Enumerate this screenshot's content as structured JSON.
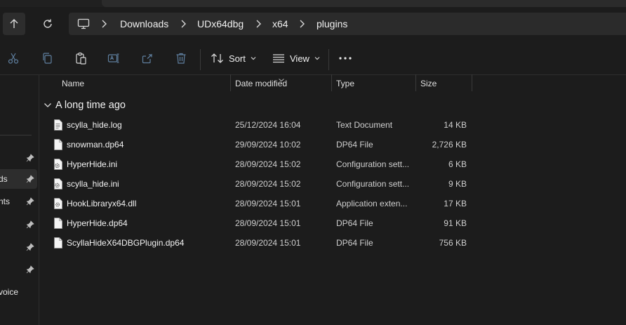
{
  "breadcrumb": {
    "items": [
      {
        "label": "Downloads"
      },
      {
        "label": "UDx64dbg"
      },
      {
        "label": "x64"
      },
      {
        "label": "plugins"
      }
    ]
  },
  "toolbar": {
    "sort_label": "Sort",
    "view_label": "View"
  },
  "sidebar": {
    "items": [
      {
        "label": ""
      },
      {
        "label": "ds"
      },
      {
        "label": "nts"
      },
      {
        "label": ""
      },
      {
        "label": ""
      },
      {
        "label": ""
      },
      {
        "label": "voice"
      }
    ]
  },
  "columns": {
    "name": "Name",
    "date": "Date modified",
    "type": "Type",
    "size": "Size"
  },
  "group": {
    "title": "A long time ago"
  },
  "files": [
    {
      "name": "scylla_hide.log",
      "date": "25/12/2024 16:04",
      "type": "Text Document",
      "size": "14 KB",
      "icon": "text-file-icon"
    },
    {
      "name": "snowman.dp64",
      "date": "29/09/2024 10:02",
      "type": "DP64 File",
      "size": "2,726 KB",
      "icon": "blank-file-icon"
    },
    {
      "name": "HyperHide.ini",
      "date": "28/09/2024 15:02",
      "type": "Configuration sett...",
      "size": "6 KB",
      "icon": "settings-file-icon"
    },
    {
      "name": "scylla_hide.ini",
      "date": "28/09/2024 15:02",
      "type": "Configuration sett...",
      "size": "9 KB",
      "icon": "settings-file-icon"
    },
    {
      "name": "HookLibraryx64.dll",
      "date": "28/09/2024 15:01",
      "type": "Application exten...",
      "size": "17 KB",
      "icon": "dll-file-icon"
    },
    {
      "name": "HyperHide.dp64",
      "date": "28/09/2024 15:01",
      "type": "DP64 File",
      "size": "91 KB",
      "icon": "blank-file-icon"
    },
    {
      "name": "ScyllaHideX64DBGPlugin.dp64",
      "date": "28/09/2024 15:01",
      "type": "DP64 File",
      "size": "756 KB",
      "icon": "blank-file-icon"
    }
  ]
}
